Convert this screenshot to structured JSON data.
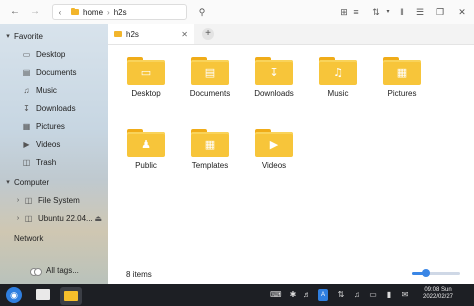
{
  "toolbar": {
    "back_icon": "arrow-left-icon",
    "forward_icon": "arrow-right-icon",
    "breadcrumbs": [
      "home",
      "h2s"
    ],
    "search_icon": "search-icon"
  },
  "sidebar": {
    "favorite_heading": "Favorite",
    "favorites": [
      {
        "label": "Desktop",
        "icon": "desktop-icon"
      },
      {
        "label": "Documents",
        "icon": "documents-icon"
      },
      {
        "label": "Music",
        "icon": "music-icon"
      },
      {
        "label": "Downloads",
        "icon": "downloads-icon"
      },
      {
        "label": "Pictures",
        "icon": "pictures-icon"
      },
      {
        "label": "Videos",
        "icon": "videos-icon"
      },
      {
        "label": "Trash",
        "icon": "trash-icon"
      }
    ],
    "computer_heading": "Computer",
    "computer_items": [
      {
        "label": "File System",
        "icon": "drive-icon"
      },
      {
        "label": "Ubuntu 22.04...",
        "icon": "drive-icon"
      }
    ],
    "network_heading": "Network",
    "all_tags": "All tags..."
  },
  "tabs": [
    {
      "label": "h2s"
    }
  ],
  "files": [
    {
      "label": "Desktop",
      "icon": "desktop-folder-icon"
    },
    {
      "label": "Documents",
      "icon": "documents-folder-icon"
    },
    {
      "label": "Downloads",
      "icon": "downloads-folder-icon"
    },
    {
      "label": "Music",
      "icon": "music-folder-icon"
    },
    {
      "label": "Pictures",
      "icon": "pictures-folder-icon"
    },
    {
      "label": "Public",
      "icon": "public-folder-icon"
    },
    {
      "label": "Templates",
      "icon": "templates-folder-icon"
    },
    {
      "label": "Videos",
      "icon": "videos-folder-icon"
    }
  ],
  "status": {
    "item_count": "8 items",
    "zoom_level": 0.3
  },
  "taskbar": {
    "time": "09:08 Sun",
    "date": "2022/02/27"
  },
  "colors": {
    "accent": "#3a86e6",
    "folder": "#f7c53a",
    "taskbar": "#1d1f24"
  }
}
